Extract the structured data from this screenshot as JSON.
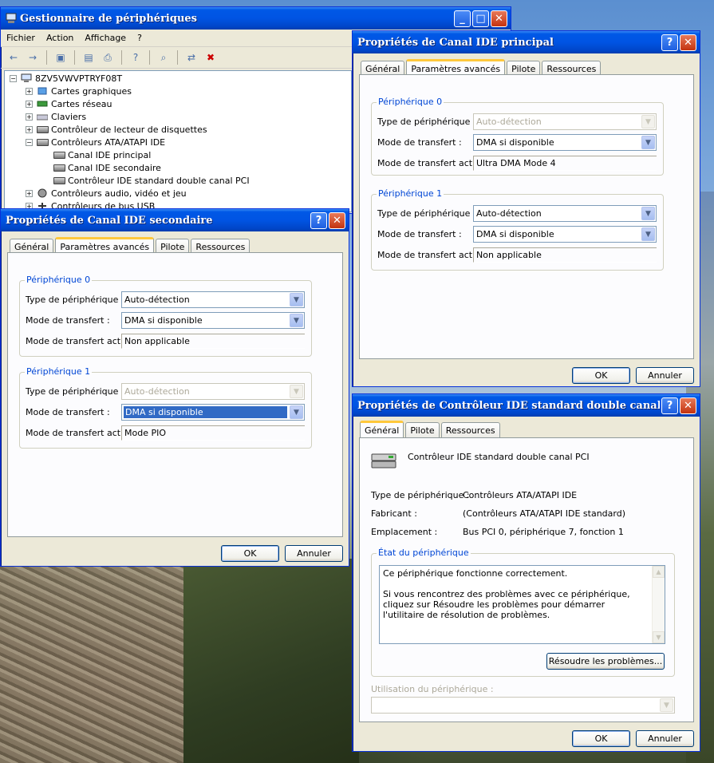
{
  "desktop": {},
  "device_manager": {
    "title": "Gestionnaire de périphériques",
    "menu": [
      "Fichier",
      "Action",
      "Affichage",
      "?"
    ],
    "tree": {
      "root": "8ZV5VWVPTRYF08T",
      "items": [
        {
          "label": "Cartes graphiques"
        },
        {
          "label": "Cartes réseau"
        },
        {
          "label": "Claviers"
        },
        {
          "label": "Contrôleur de lecteur de disquettes"
        },
        {
          "label": "Contrôleurs ATA/ATAPI IDE"
        },
        {
          "label": "Canal IDE principal"
        },
        {
          "label": "Canal IDE secondaire"
        },
        {
          "label": "Contrôleur IDE standard double canal PCI"
        },
        {
          "label": "Contrôleurs audio, vidéo et jeu"
        },
        {
          "label": "Contrôleurs de bus USB"
        }
      ]
    }
  },
  "primary_dialog": {
    "title": "Propriétés de Canal IDE principal",
    "tabs": [
      "Général",
      "Paramètres avancés",
      "Pilote",
      "Ressources"
    ],
    "device0": {
      "title": "Périphérique 0",
      "type_label": "Type de périphérique :",
      "type_value": "Auto-détection",
      "mode_label": "Mode de transfert :",
      "mode_value": "DMA si disponible",
      "active_label": "Mode de transfert actif :",
      "active_value": "Ultra DMA Mode 4"
    },
    "device1": {
      "title": "Périphérique 1",
      "type_label": "Type de périphérique :",
      "type_value": "Auto-détection",
      "mode_label": "Mode de transfert :",
      "mode_value": "DMA si disponible",
      "active_label": "Mode de transfert actif :",
      "active_value": "Non applicable"
    },
    "ok": "OK",
    "cancel": "Annuler"
  },
  "secondary_dialog": {
    "title": "Propriétés de Canal IDE secondaire",
    "tabs": [
      "Général",
      "Paramètres avancés",
      "Pilote",
      "Ressources"
    ],
    "device0": {
      "title": "Périphérique 0",
      "type_label": "Type de périphérique :",
      "type_value": "Auto-détection",
      "mode_label": "Mode de transfert :",
      "mode_value": "DMA si disponible",
      "active_label": "Mode de transfert actif :",
      "active_value": "Non applicable"
    },
    "device1": {
      "title": "Périphérique 1",
      "type_label": "Type de périphérique :",
      "type_value": "Auto-détection",
      "mode_label": "Mode de transfert :",
      "mode_value": "DMA si disponible",
      "active_label": "Mode de transfert actif :",
      "active_value": "Mode PIO"
    },
    "ok": "OK",
    "cancel": "Annuler"
  },
  "controller_dialog": {
    "title": "Propriétés de Contrôleur IDE standard double canal PCI",
    "tabs": [
      "Général",
      "Pilote",
      "Ressources"
    ],
    "device_name": "Contrôleur IDE standard double canal PCI",
    "type_label": "Type de périphérique :",
    "type_value": "Contrôleurs ATA/ATAPI IDE",
    "maker_label": "Fabricant :",
    "maker_value": "(Contrôleurs ATA/ATAPI IDE standard)",
    "location_label": "Emplacement :",
    "location_value": "Bus PCI 0, périphérique 7, fonction 1",
    "status_title": "État du périphérique",
    "status_line1": "Ce périphérique fonctionne correctement.",
    "status_line2": "Si vous rencontrez des problèmes avec ce périphérique, cliquez sur Résoudre les problèmes pour démarrer l'utilitaire de résolution de problèmes.",
    "troubleshoot": "Résoudre les problèmes...",
    "usage_label": "Utilisation du périphérique :",
    "ok": "OK",
    "cancel": "Annuler"
  }
}
